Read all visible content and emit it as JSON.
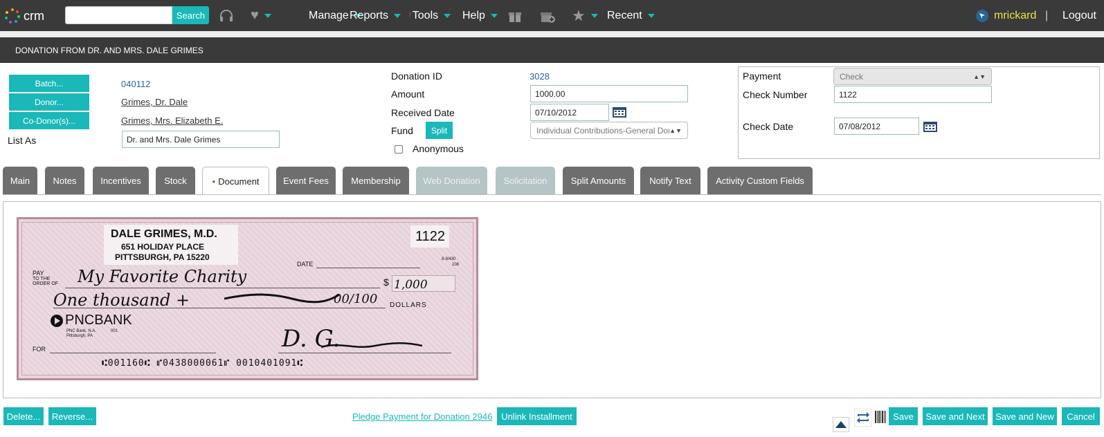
{
  "topbar": {
    "logo_text": "crm",
    "search_placeholder": "",
    "search_label": "Search",
    "nav": {
      "manage": "Manage",
      "reports": "Reports",
      "tools": "Tools",
      "help": "Help",
      "recent": "Recent"
    },
    "user": "mrickard",
    "separator": "|",
    "logout": "Logout"
  },
  "title": "DONATION FROM DR. AND MRS. DALE GRIMES",
  "left": {
    "batch_label": "Batch...",
    "batch_value": "040112",
    "donor_label": "Donor...",
    "donor_value": "Grimes, Dr. Dale",
    "codonor_label": "Co-Donor(s)...",
    "codonor_value": "Grimes, Mrs. Elizabeth E.",
    "list_as_label": "List As",
    "list_as_value": "Dr. and Mrs. Dale Grimes"
  },
  "middle": {
    "donation_id_label": "Donation ID",
    "donation_id_value": "3028",
    "amount_label": "Amount",
    "amount_value": "1000.00",
    "received_label": "Received Date",
    "received_value": "07/10/2012",
    "fund_label": "Fund",
    "split_label": "Split",
    "fund_value": "Individual Contributions-General Don",
    "anonymous_label": "Anonymous"
  },
  "payment": {
    "payment_label": "Payment",
    "payment_value": "Check",
    "check_number_label": "Check Number",
    "check_number_value": "1122",
    "check_date_label": "Check Date",
    "check_date_value": "07/08/2012"
  },
  "tabs": [
    "Main",
    "Notes",
    "Incentives",
    "Stock",
    "Document",
    "Event Fees",
    "Membership",
    "Web Donation",
    "Solicitation",
    "Split Amounts",
    "Notify Text",
    "Activity Custom Fields"
  ],
  "check": {
    "name": "DALE GRIMES, M.D.",
    "address1": "651 HOLIDAY PLACE",
    "address2": "PITTSBURGH, PA 15220",
    "number": "1122",
    "date_label": "DATE",
    "routing_small": "8-9/430",
    "routing_small2": "108",
    "pay_label": "PAY",
    "order_label": "TO THE\nORDER OF",
    "payee": "My Favorite Charity",
    "dollar_sign": "$",
    "amount": "1,000",
    "amount_words": "One thousand +",
    "cents": "00/100",
    "dollars_label": "DOLLARS",
    "bank": "PNCBANK",
    "bank_sub1": "PNC Bank, N.A.",
    "bank_sub2": "Pittsburgh, PA",
    "bank_code": "001",
    "for_label": "FOR",
    "micr": "⑆001160⑆ ⑈0438000061⑈ 0010401091⑆",
    "signature": "D. G."
  },
  "bottom": {
    "delete": "Delete...",
    "reverse": "Reverse...",
    "pledge_link": "Pledge Payment for Donation 2946",
    "unlink": "Unlink Installment",
    "save": "Save",
    "save_next": "Save and Next",
    "save_new": "Save and New",
    "cancel": "Cancel"
  },
  "colors": {
    "accent": "#1ab8b8",
    "topbar": "#3a3a3a",
    "user": "#e8e24a"
  }
}
